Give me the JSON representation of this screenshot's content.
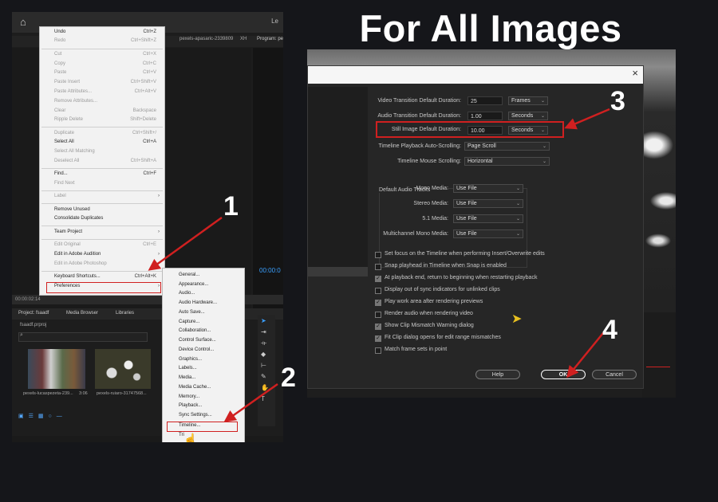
{
  "heading": "For All Images",
  "steps": [
    "1",
    "2",
    "3",
    "4"
  ],
  "accent_color": "#d02020",
  "left": {
    "title_right": "Le",
    "source_tab": "pexels-apasaric-2339809",
    "source_tab2": "XH",
    "program_tab": "Program: pe",
    "timecode": "00:00:0",
    "timebar": "00:00:02:14",
    "project_tabs": [
      "Project: fsaadf",
      "Media Browser",
      "Libraries"
    ],
    "project_file": "fsaadf.prproj",
    "clip1": "pexels-lucaspezeta-239...",
    "clip1_dur": "3:06",
    "clip2": "pexels-ruiaro-31747568...",
    "edit_menu": [
      {
        "label": "Undo",
        "shortcut": "Ctrl+Z",
        "disabled": false
      },
      {
        "label": "Redo",
        "shortcut": "Ctrl+Shift+Z",
        "disabled": true
      },
      {
        "label": "Cut",
        "shortcut": "Ctrl+X",
        "disabled": true
      },
      {
        "label": "Copy",
        "shortcut": "Ctrl+C",
        "disabled": true
      },
      {
        "label": "Paste",
        "shortcut": "Ctrl+V",
        "disabled": true
      },
      {
        "label": "Paste Insert",
        "shortcut": "Ctrl+Shift+V",
        "disabled": true
      },
      {
        "label": "Paste Attributes...",
        "shortcut": "Ctrl+Alt+V",
        "disabled": true
      },
      {
        "label": "Remove Attributes...",
        "shortcut": "",
        "disabled": true
      },
      {
        "label": "Clear",
        "shortcut": "Backspace",
        "disabled": true
      },
      {
        "label": "Ripple Delete",
        "shortcut": "Shift+Delete",
        "disabled": true
      },
      {
        "label": "Duplicate",
        "shortcut": "Ctrl+Shift+/",
        "disabled": true
      },
      {
        "label": "Select All",
        "shortcut": "Ctrl+A",
        "disabled": false
      },
      {
        "label": "Select All Matching",
        "shortcut": "",
        "disabled": true
      },
      {
        "label": "Deselect All",
        "shortcut": "Ctrl+Shift+A",
        "disabled": true
      },
      {
        "label": "Find...",
        "shortcut": "Ctrl+F",
        "disabled": false
      },
      {
        "label": "Find Next",
        "shortcut": "",
        "disabled": true
      },
      {
        "label": "Label",
        "shortcut": "",
        "disabled": true
      },
      {
        "label": "Remove Unused",
        "shortcut": "",
        "disabled": false
      },
      {
        "label": "Consolidate Duplicates",
        "shortcut": "",
        "disabled": false
      },
      {
        "label": "Team Project",
        "shortcut": "",
        "disabled": false
      },
      {
        "label": "Edit Original",
        "shortcut": "Ctrl+E",
        "disabled": true
      },
      {
        "label": "Edit in Adobe Audition",
        "shortcut": "",
        "disabled": false
      },
      {
        "label": "Edit in Adobe Photoshop",
        "shortcut": "",
        "disabled": true
      },
      {
        "label": "Keyboard Shortcuts...",
        "shortcut": "Ctrl+Alt+K",
        "disabled": false
      },
      {
        "label": "Preferences",
        "shortcut": "",
        "disabled": false
      }
    ],
    "prefs_menu": [
      "General...",
      "Appearance...",
      "Audio...",
      "Audio Hardware...",
      "Auto Save...",
      "Capture...",
      "Collaboration...",
      "Control Surface...",
      "Device Control...",
      "Graphics...",
      "Labels...",
      "Media...",
      "Media Cache...",
      "Memory...",
      "Playback...",
      "Sync Settings...",
      "Timeline...",
      "Tri"
    ]
  },
  "dialog": {
    "video_transition_label": "Video Transition Default Duration:",
    "video_transition_value": "25",
    "video_transition_unit": "Frames",
    "audio_transition_label": "Audio Transition Default Duration:",
    "audio_transition_value": "1.00",
    "audio_transition_unit": "Seconds",
    "still_image_label": "Still Image Default Duration:",
    "still_image_value": "10.00",
    "still_image_unit": "Seconds",
    "playback_scroll_label": "Timeline Playback Auto-Scrolling:",
    "playback_scroll_value": "Page Scroll",
    "mouse_scroll_label": "Timeline Mouse Scrolling:",
    "mouse_scroll_value": "Horizontal",
    "audio_tracks_title": "Default Audio Tracks",
    "audio_tracks": [
      {
        "label": "Mono Media:",
        "value": "Use File"
      },
      {
        "label": "Stereo Media:",
        "value": "Use File"
      },
      {
        "label": "5.1 Media:",
        "value": "Use File"
      },
      {
        "label": "Multichannel Mono Media:",
        "value": "Use File"
      }
    ],
    "checkboxes": [
      {
        "label": "Set focus on the Timeline when performing Insert/Overwrite edits",
        "checked": false
      },
      {
        "label": "Snap playhead in Timeline when Snap is enabled",
        "checked": false
      },
      {
        "label": "At playback end, return to beginning when restarting playback",
        "checked": true
      },
      {
        "label": "Display out of sync indicators for unlinked clips",
        "checked": false
      },
      {
        "label": "Play work area after rendering previews",
        "checked": true
      },
      {
        "label": "Render audio when rendering video",
        "checked": false
      },
      {
        "label": "Show Clip Mismatch Warning dialog",
        "checked": true
      },
      {
        "label": "Fit Clip dialog opens for edit range mismatches",
        "checked": true
      },
      {
        "label": "Match frame sets in point",
        "checked": false
      }
    ],
    "help_label": "Help",
    "ok_label": "OK",
    "cancel_label": "Cancel"
  }
}
